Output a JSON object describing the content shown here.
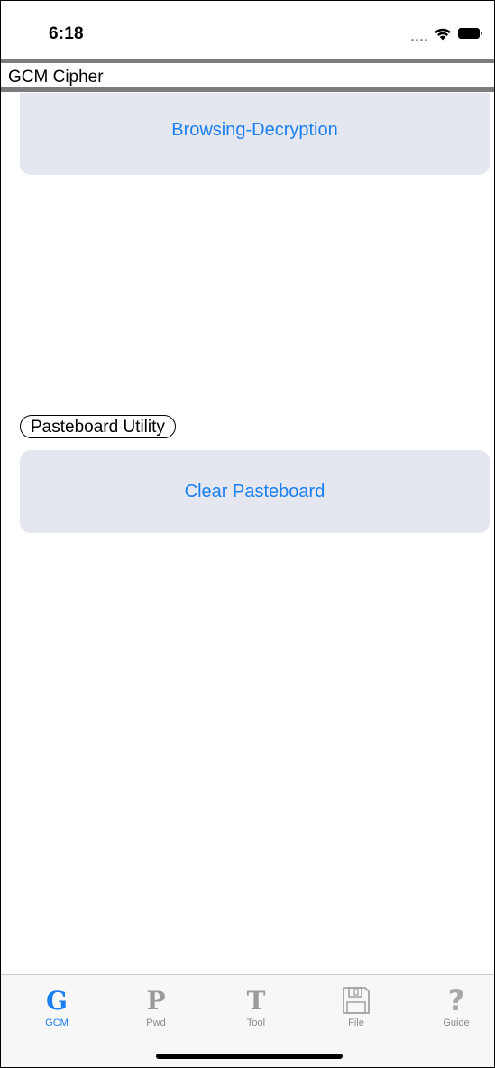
{
  "status_bar": {
    "time": "6:18",
    "icons": [
      "cellular-signal-icon",
      "wifi-icon",
      "battery-icon"
    ]
  },
  "header": {
    "title": "GCM Cipher"
  },
  "main": {
    "browse_button_label": "Browsing-Decryption",
    "pasteboard_section_label": "Pasteboard Utility",
    "clear_button_label": "Clear Pasteboard"
  },
  "tab_bar": {
    "active": "GCM",
    "tabs": [
      {
        "label": "GCM",
        "glyph": "G",
        "icon": "g-letter-icon"
      },
      {
        "label": "Pwd",
        "glyph": "P",
        "icon": "p-letter-icon"
      },
      {
        "label": "Tool",
        "glyph": "T",
        "icon": "t-letter-icon"
      },
      {
        "label": "File",
        "glyph": "",
        "icon": "floppy-disk-icon"
      },
      {
        "label": "Guide",
        "glyph": "?",
        "icon": "question-mark-icon"
      }
    ]
  },
  "colors": {
    "accent": "#1a7ff0",
    "button_background": "#e4e7ef",
    "inactive_tab": "#9a9a9a",
    "title_rule": "#7c7c7c"
  }
}
